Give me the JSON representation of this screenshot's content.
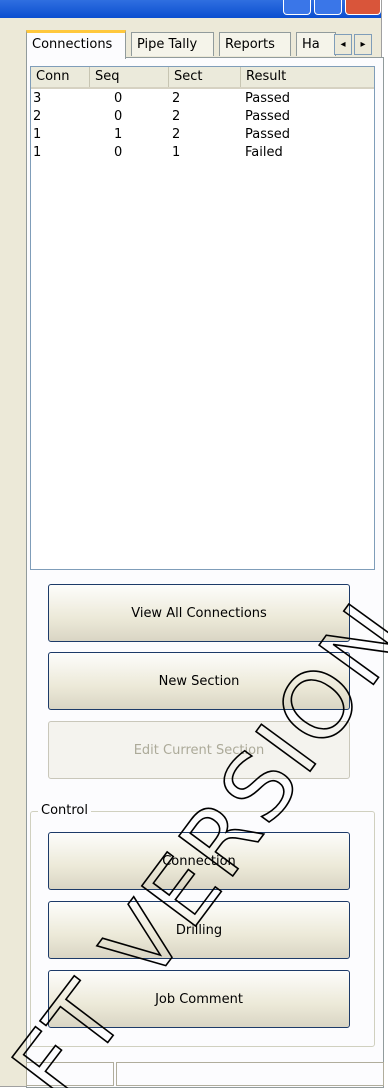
{
  "tabs": [
    {
      "label": "Connections",
      "active": true
    },
    {
      "label": "Pipe Tally",
      "active": false
    },
    {
      "label": "Reports",
      "active": false
    },
    {
      "label": "Ha",
      "active": false
    }
  ],
  "tab_scroll": {
    "left": "◂",
    "right": "▸"
  },
  "connections_table": {
    "columns": [
      "Conn",
      "Seq",
      "Sect",
      "Result"
    ],
    "rows": [
      [
        "3",
        "0",
        "2",
        "Passed"
      ],
      [
        "2",
        "0",
        "2",
        "Passed"
      ],
      [
        "1",
        "1",
        "2",
        "Passed"
      ],
      [
        "1",
        "0",
        "1",
        "Failed"
      ]
    ]
  },
  "buttons": {
    "view_all": "View All Connections",
    "new_section": "New Section",
    "edit_section": "Edit Current Section"
  },
  "control_group": {
    "title": "Control",
    "connection": "Connection",
    "drilling": "Drilling",
    "job_comment": "Job Comment"
  },
  "watermark": {
    "text": "FT VERSION"
  },
  "colors": {
    "window_bg": "#ece9d8",
    "titlebar": "#0a4ed0",
    "close_button": "#d9553a",
    "tab_highlight": "#ffc83c",
    "button_border": "#1c3a68",
    "disabled_text": "#acaa99"
  }
}
